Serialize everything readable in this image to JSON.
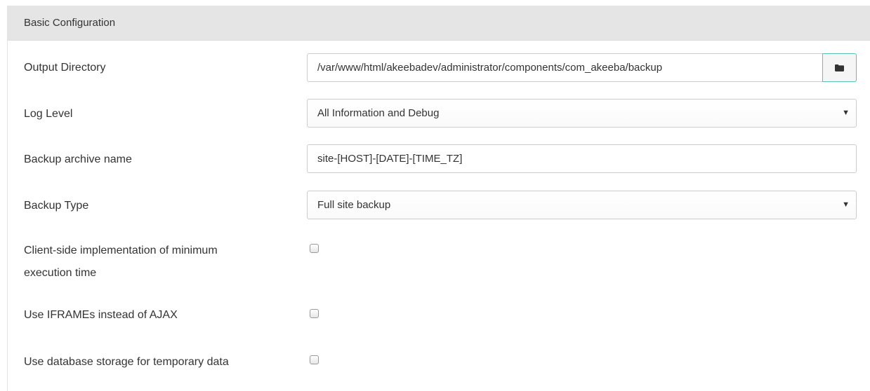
{
  "panel": {
    "title": "Basic Configuration"
  },
  "fields": {
    "output_directory": {
      "label": "Output Directory",
      "value": "/var/www/html/akeebadev/administrator/components/com_akeeba/backup",
      "button_icon": "folder-icon"
    },
    "log_level": {
      "label": "Log Level",
      "selected": "All Information and Debug"
    },
    "archive_name": {
      "label": "Backup archive name",
      "value": "site-[HOST]-[DATE]-[TIME_TZ]"
    },
    "backup_type": {
      "label": "Backup Type",
      "selected": "Full site backup"
    },
    "client_side_min_exec": {
      "label_line1": "Client-side implementation of minimum",
      "label_line2": "execution time",
      "checked": false
    },
    "use_iframes": {
      "label": "Use IFRAMEs instead of AJAX",
      "checked": false
    },
    "db_storage": {
      "label": "Use database storage for temporary data",
      "checked": false
    }
  },
  "colors": {
    "header_bg": "#e5e5e5",
    "button_border": "#5bc0b5",
    "text": "#333333"
  }
}
